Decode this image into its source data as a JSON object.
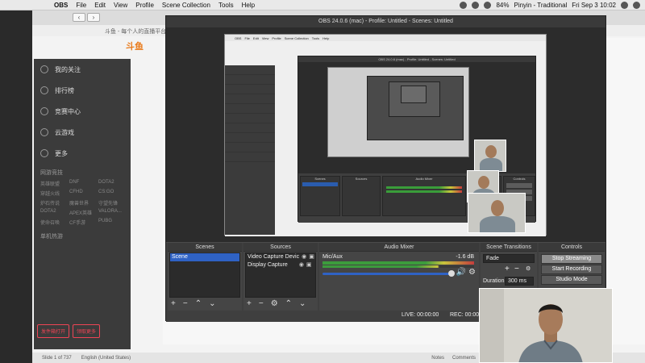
{
  "menubar": {
    "app": "OBS",
    "items": [
      "File",
      "Edit",
      "View",
      "Profile",
      "Scene Collection",
      "Tools",
      "Help"
    ],
    "battery": "84%",
    "input_method": "Pinyin - Traditional",
    "clock": "Fri Sep 3  10:02"
  },
  "browser": {
    "subtitle": "斗鱼 - 每个人的直播平台",
    "logo": "斗鱼",
    "sidebar": {
      "items": [
        "我的关注",
        "排行榜",
        "竞赛中心",
        "云游戏",
        "更多"
      ],
      "section_games": "网游竞技",
      "games": [
        "英雄联盟",
        "DNF",
        "DOTA2",
        "穿越火线",
        "CFHD",
        "CS:GO",
        "炉石传说",
        "魔兽世界",
        "守望先锋",
        "DOTA2",
        "APEX英雄",
        "VALORA...",
        "使命召唤",
        "CF手游",
        "PUBG"
      ],
      "section_mobile": "单机热游",
      "promo": [
        "发件箱打开",
        "领取更多"
      ]
    },
    "status": {
      "slide": "Slide 1 of 737",
      "language": "English (United States)",
      "notes": "Notes",
      "comments": "Comments"
    }
  },
  "obs": {
    "title": "OBS 24.0.6 (mac) - Profile: Untitled - Scenes: Untitled",
    "docks": {
      "scenes": {
        "header": "Scenes",
        "items": [
          "Scene"
        ]
      },
      "sources": {
        "header": "Sources",
        "items": [
          "Video Capture Devic",
          "Display Capture"
        ]
      },
      "mixer": {
        "header": "Audio Mixer",
        "track": "Mic/Aux",
        "db": "-1.6 dB"
      },
      "transitions": {
        "header": "Scene Transitions",
        "transition": "Fade",
        "duration_label": "Duration",
        "duration": "300 ms"
      },
      "controls": {
        "header": "Controls",
        "stop_streaming": "Stop Streaming",
        "start_recording": "Start Recording",
        "studio_mode": "Studio Mode"
      }
    },
    "status": {
      "live": "LIVE: 00:00:00",
      "rec": "REC: 00:00:00"
    }
  }
}
